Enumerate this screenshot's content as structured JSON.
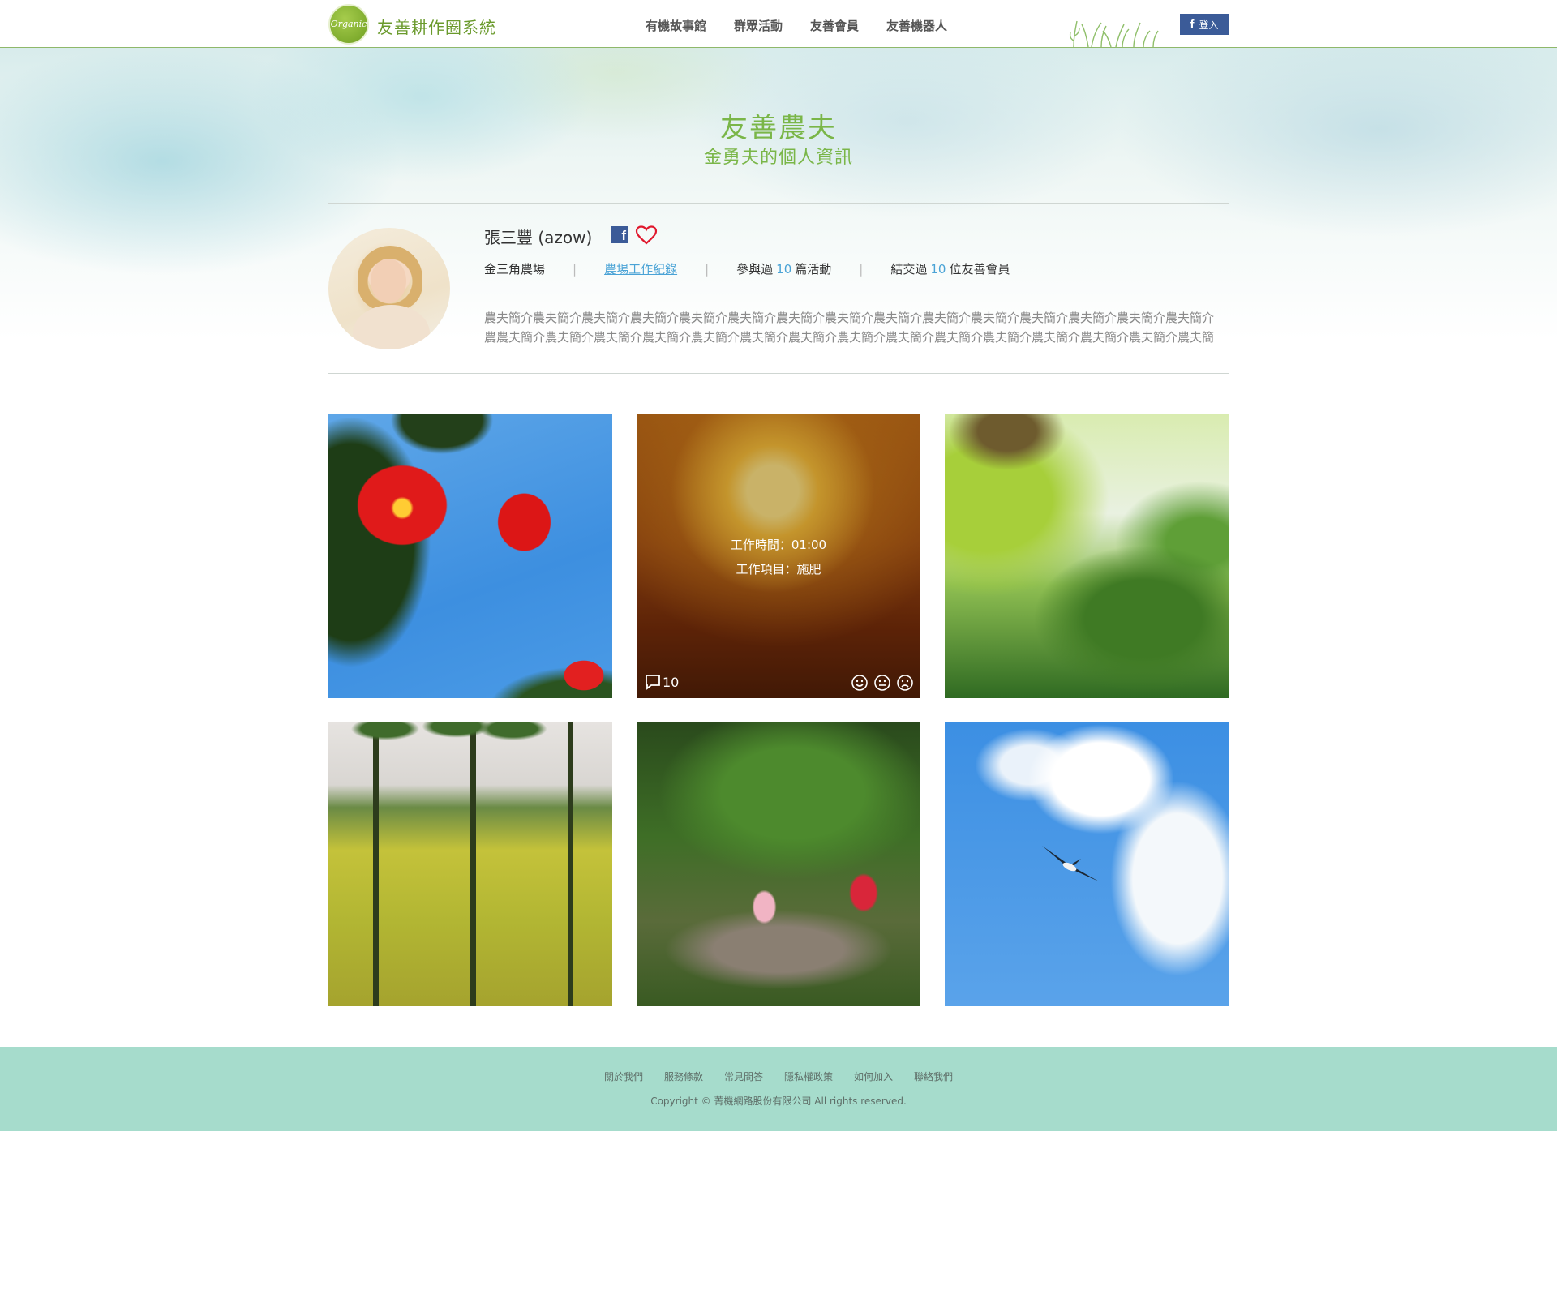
{
  "header": {
    "logo_text": "Organic",
    "site_title": "友善耕作圈系統",
    "nav": [
      "有機故事館",
      "群眾活動",
      "友善會員",
      "友善機器人"
    ],
    "login_label": "登入",
    "login_icon": "facebook-icon"
  },
  "hero": {
    "title": "友善農夫",
    "subtitle": "金勇夫的個人資訊"
  },
  "profile": {
    "name": "張三豐 (azow)",
    "farm": "金三角農場",
    "work_log_link": "農場工作紀錄",
    "events_prefix": "參與過",
    "events_count": "10",
    "events_suffix": "篇活動",
    "friends_prefix": "結交過",
    "friends_count": "10",
    "friends_suffix": "位友善會員",
    "bio": "農夫簡介農夫簡介農夫簡介農夫簡介農夫簡介農夫簡介農夫簡介農夫簡介農夫簡介農夫簡介農夫簡介農夫簡介農夫簡介農夫簡介農夫簡介農農夫簡介農夫簡介農夫簡介農夫簡介農夫簡介農夫簡介農夫簡介農夫簡介農夫簡介農夫簡介農夫簡介農夫簡介農夫簡介農夫簡介農夫簡介農",
    "accent_color": "#4aa3d6",
    "heading_color": "#7ab648"
  },
  "gallery": {
    "hover_tile": {
      "work_time": "工作時間：01:00",
      "work_item": "工作項目：施肥",
      "comment_count": "10",
      "reactions": [
        "smile-icon",
        "neutral-icon",
        "sad-icon"
      ]
    }
  },
  "footer": {
    "links": [
      "關於我們",
      "服務條款",
      "常見問答",
      "隱私權政策",
      "如何加入",
      "聯絡我們"
    ],
    "copyright": "Copyright © 菁機網路股份有限公司 All rights reserved."
  }
}
